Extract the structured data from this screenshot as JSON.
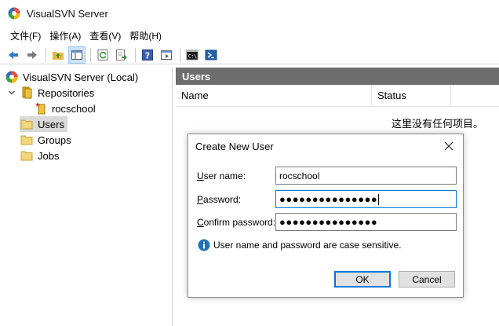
{
  "window": {
    "title": "VisualSVN Server",
    "icon": "visualsvn-logo"
  },
  "menu": [
    {
      "label": "文件(F)"
    },
    {
      "label": "操作(A)"
    },
    {
      "label": "查看(V)"
    },
    {
      "label": "帮助(H)"
    }
  ],
  "toolbar": {
    "icons": [
      "back-arrow-icon",
      "forward-arrow-icon",
      "up-folder-icon",
      "show-hide-tree-icon",
      "refresh-icon",
      "export-icon",
      "help-icon",
      "view-icon",
      "console-icon",
      "powershell-icon"
    ]
  },
  "tree": {
    "root": "VisualSVN Server (Local)",
    "repositories": "Repositories",
    "repo_item": "rocschool",
    "users": "Users",
    "groups": "Groups",
    "jobs": "Jobs"
  },
  "right_pane": {
    "header": "Users",
    "columns": [
      "Name",
      "Status"
    ],
    "empty_text": "这里没有任何项目。"
  },
  "dialog": {
    "title": "Create New User",
    "username_label_u": "U",
    "username_label_rest": "ser name:",
    "username_value": "rocschool",
    "password_label_u": "P",
    "password_label_rest": "assword:",
    "password_value": "●●●●●●●●●●●●●●●",
    "confirm_label_u": "C",
    "confirm_label_rest": "onfirm password:",
    "confirm_value": "●●●●●●●●●●●●●●●",
    "info_text": "User name and password are case sensitive.",
    "ok_label": "OK",
    "cancel_label": "Cancel"
  },
  "colors": {
    "header_bg": "#6d6d6d",
    "selection": "#d9d9d9",
    "focus_border": "#0078d7",
    "info_icon": "#1e73be"
  }
}
